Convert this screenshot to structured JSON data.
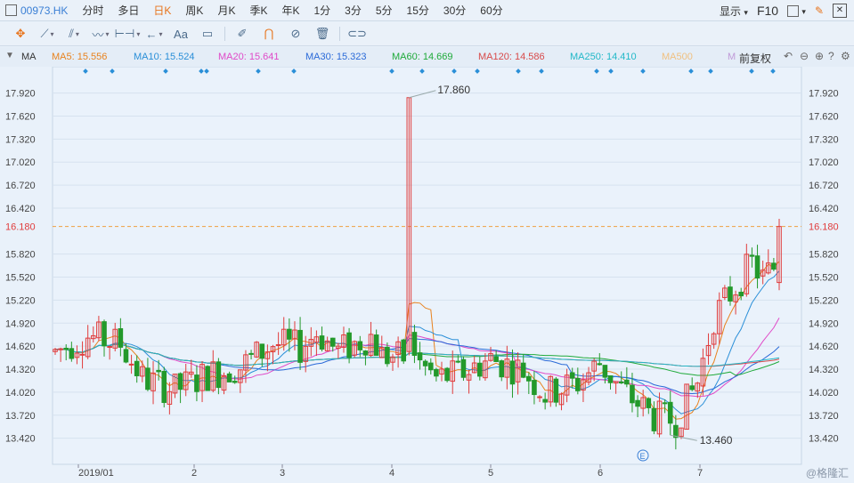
{
  "header": {
    "symbol": "00973.HK",
    "periods": [
      "分时",
      "多日",
      "日K",
      "周K",
      "月K",
      "季K",
      "年K",
      "1分",
      "3分",
      "5分",
      "15分",
      "30分",
      "60分"
    ],
    "active_period": "日K",
    "display_label": "显示",
    "f10_label": "F10"
  },
  "toolbar": {
    "icons": [
      "move-crosshair-icon",
      "line-tool-icon",
      "channel-tool-icon",
      "wave-tool-icon",
      "range-tool-icon",
      "arrow-tool-icon",
      "text-tool-icon",
      "comment-tool-icon",
      "pencil-icon",
      "magnet-icon",
      "hide-icon",
      "delete-icon",
      "link-icon"
    ],
    "text_tool_label": "Aa"
  },
  "ma_bar": {
    "title": "MA",
    "items": [
      {
        "label": "MA5: 15.556",
        "color": "#e8821e"
      },
      {
        "label": "MA10: 15.524",
        "color": "#2a8fd8"
      },
      {
        "label": "MA20: 15.641",
        "color": "#e04ac8"
      },
      {
        "label": "MA30: 15.323",
        "color": "#2a6ad8"
      },
      {
        "label": "MA60: 14.669",
        "color": "#1faa3a"
      },
      {
        "label": "MA120: 14.586",
        "color": "#d84a4a"
      },
      {
        "label": "MA250: 14.410",
        "color": "#21b8c8"
      },
      {
        "label": "MA500",
        "color": "#f0c080"
      },
      {
        "label": "M",
        "color": "#c09ad8"
      }
    ],
    "adjust_label": "前复权"
  },
  "chart_data": {
    "type": "candlestick",
    "ytick_labels": [
      "17.920",
      "17.620",
      "17.320",
      "17.020",
      "16.720",
      "16.420",
      "16.180",
      "15.820",
      "15.520",
      "15.220",
      "14.920",
      "14.620",
      "14.320",
      "14.020",
      "13.720",
      "13.420"
    ],
    "ylim": [
      13.2,
      18.1
    ],
    "xtick_labels": [
      "2019/01",
      "2",
      "3",
      "4",
      "5",
      "6",
      "7"
    ],
    "last_price": 16.18,
    "last_price_label": "16.180",
    "max_label": "17.860",
    "min_label": "13.460",
    "event_marker": "E",
    "up_color": "#e03c3c",
    "down_color": "#23992b",
    "current_line_color": "#f0a040",
    "dividend_marks": 21,
    "watermark": "@格隆汇"
  }
}
